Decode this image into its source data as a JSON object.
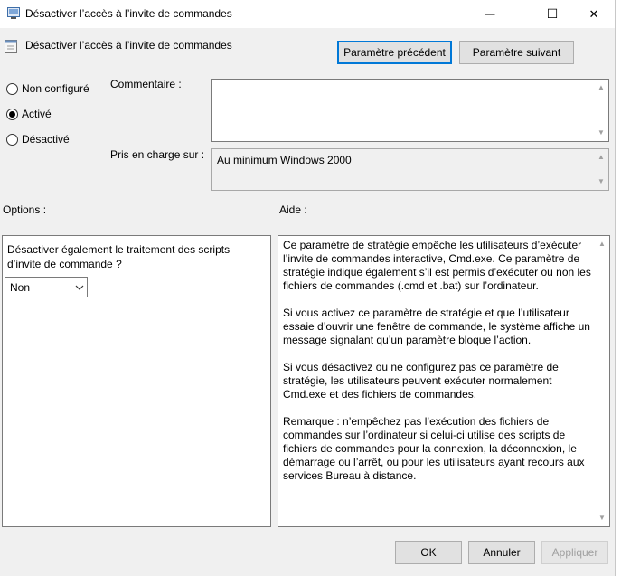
{
  "window": {
    "title": "Désactiver l’accès à l’invite de commandes",
    "minimize_glyph": "—",
    "maximize_glyph": "☐",
    "close_glyph": "✕"
  },
  "header": {
    "policy_name": "Désactiver l’accès à l’invite de commandes",
    "prev_button": "Paramètre précédent",
    "next_button": "Paramètre suivant"
  },
  "state": {
    "options": [
      {
        "label": "Non configuré",
        "selected": false
      },
      {
        "label": "Activé",
        "selected": true
      },
      {
        "label": "Désactivé",
        "selected": false
      }
    ]
  },
  "comment": {
    "label": "Commentaire :",
    "value": ""
  },
  "supported": {
    "label": "Pris en charge sur :",
    "value": "Au minimum Windows 2000"
  },
  "options_section": {
    "label": "Options :",
    "question": "Désactiver également le traitement des scripts d’invite de commande ?",
    "select_value": "Non"
  },
  "help_section": {
    "label": "Aide :",
    "paragraphs": [
      "Ce paramètre de stratégie empêche les utilisateurs d’exécuter l’invite de commandes interactive, Cmd.exe.  Ce paramètre de stratégie indique également s’il est permis d’exécuter ou non les fichiers de commandes (.cmd et .bat) sur l’ordinateur.",
      "Si vous activez ce paramètre de stratégie et que l’utilisateur essaie d’ouvrir une fenêtre de commande, le système affiche un message signalant qu’un paramètre bloque l’action.",
      "Si vous désactivez ou ne configurez pas ce paramètre de stratégie, les utilisateurs peuvent exécuter normalement Cmd.exe et des fichiers de commandes.",
      "Remarque : n’empêchez pas l’exécution des fichiers de commandes sur l’ordinateur si celui-ci utilise des scripts de fichiers de commandes pour la connexion, la déconnexion, le démarrage ou l’arrêt, ou pour les utilisateurs ayant recours aux services Bureau à distance."
    ]
  },
  "footer": {
    "ok": "OK",
    "cancel": "Annuler",
    "apply": "Appliquer"
  }
}
